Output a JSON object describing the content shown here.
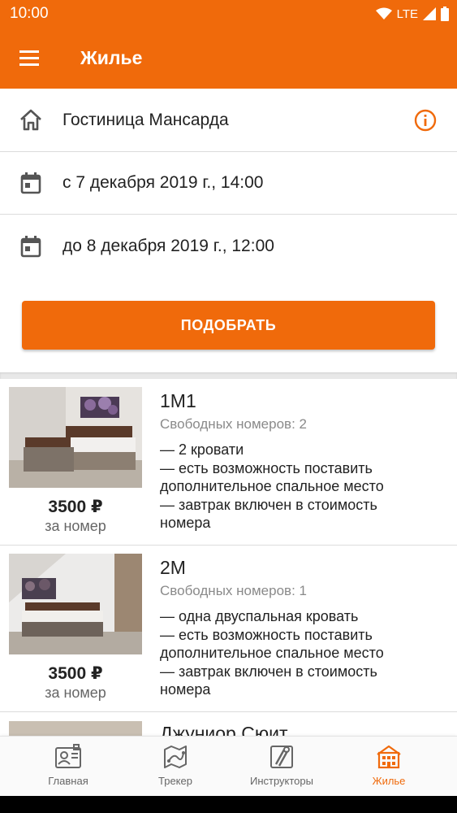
{
  "status": {
    "time": "10:00",
    "network": "LTE"
  },
  "appbar": {
    "title": "Жилье"
  },
  "hotel": {
    "name": "Гостиница Мансарда"
  },
  "dates": {
    "checkin": "с 7 декабря 2019 г., 14:00",
    "checkout": "до 8 декабря 2019 г., 12:00"
  },
  "search_button": "ПОДОБРАТЬ",
  "rooms": [
    {
      "name": "1М1",
      "availability": "Свободных номеров: 2",
      "features": [
        "— 2 кровати",
        "— есть возможность поставить",
        "дополнительное спальное место",
        "— завтрак включен в стоимость",
        "номера"
      ],
      "price": "3500 ₽",
      "price_unit": "за номер"
    },
    {
      "name": "2М",
      "availability": "Свободных номеров: 1",
      "features": [
        "— одна двуспальная кровать",
        "— есть возможность поставить",
        "дополнительное спальное место",
        "— завтрак включен в стоимость",
        "номера"
      ],
      "price": "3500 ₽",
      "price_unit": "за номер"
    },
    {
      "name": "Джуниор Сюит"
    }
  ],
  "bottom_nav": [
    {
      "label": "Главная",
      "icon": "id-card-icon"
    },
    {
      "label": "Трекер",
      "icon": "map-route-icon"
    },
    {
      "label": "Инструкторы",
      "icon": "ski-icon"
    },
    {
      "label": "Жилье",
      "icon": "building-icon",
      "active": true
    }
  ],
  "colors": {
    "accent": "#f06a0b",
    "text": "#222222",
    "muted": "#8a8a8a"
  }
}
